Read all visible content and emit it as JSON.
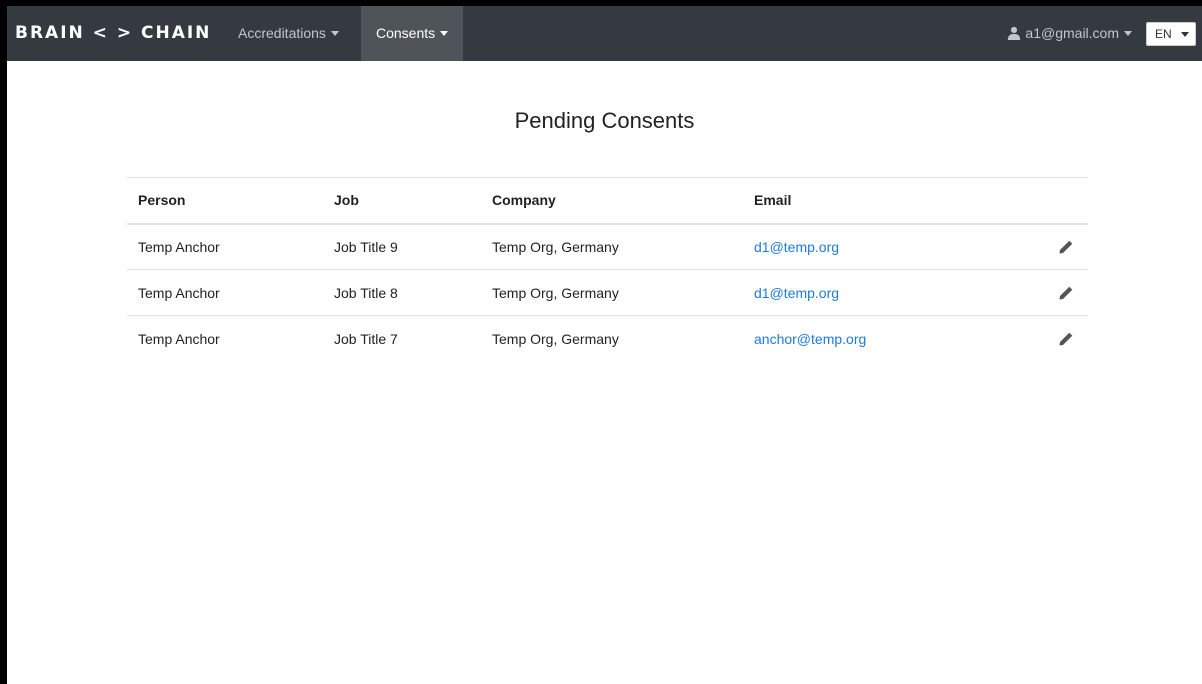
{
  "navbar": {
    "brand": "BRAIN < > CHAIN",
    "menu_accreditations": "Accreditations",
    "menu_consents": "Consents",
    "user_email": "a1@gmail.com",
    "language": "EN"
  },
  "page": {
    "title": "Pending Consents"
  },
  "table": {
    "headers": [
      "Person",
      "Job",
      "Company",
      "Email"
    ],
    "rows": [
      {
        "person": "Temp Anchor",
        "job": "Job Title 9",
        "company": "Temp Org, Germany",
        "email": "d1@temp.org"
      },
      {
        "person": "Temp Anchor",
        "job": "Job Title 8",
        "company": "Temp Org, Germany",
        "email": "d1@temp.org"
      },
      {
        "person": "Temp Anchor",
        "job": "Job Title 7",
        "company": "Temp Org, Germany",
        "email": "anchor@temp.org"
      }
    ]
  },
  "icons": {
    "user": "user-icon",
    "edit": "pencil-icon",
    "dropdown": "caret-down-icon"
  },
  "colors": {
    "navbar_bg": "#343a40",
    "active_nav_bg": "#4f5459",
    "link": "#1e7be0"
  }
}
